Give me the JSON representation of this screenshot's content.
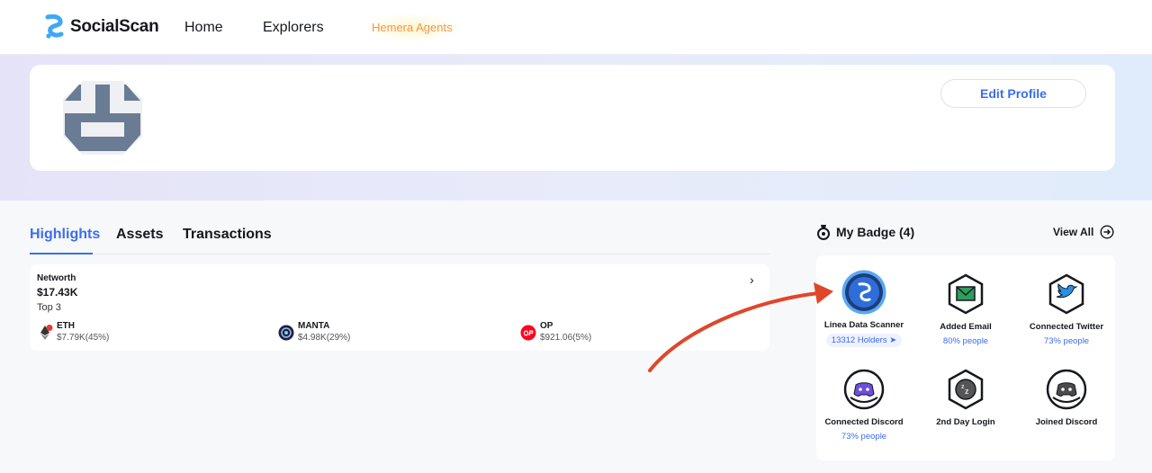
{
  "nav": {
    "brand": "SocialScan",
    "links": [
      "Home",
      "Explorers"
    ],
    "agents_label": "Hemera Agents"
  },
  "profile": {
    "edit_label": "Edit Profile"
  },
  "tabs": [
    "Highlights",
    "Assets",
    "Transactions"
  ],
  "networth": {
    "label": "Networth",
    "value": "$17.43K",
    "top_label": "Top 3",
    "assets": [
      {
        "name": "ETH",
        "value": "$7.79K(45%)"
      },
      {
        "name": "MANTA",
        "value": "$4.98K(29%)"
      },
      {
        "name": "OP",
        "value": "$921.06(5%)"
      }
    ]
  },
  "badges": {
    "title": "My Badge (4)",
    "view_all": "View All",
    "items": [
      {
        "name": "Linea Data Scanner",
        "sub": "13312 Holders",
        "icon": "linea-data-scanner-badge"
      },
      {
        "name": "Added Email",
        "sub": "80% people",
        "icon": "email-badge"
      },
      {
        "name": "Connected Twitter",
        "sub": "73% people",
        "icon": "twitter-badge"
      },
      {
        "name": "Connected Discord",
        "sub": "73% people",
        "icon": "discord-badge"
      },
      {
        "name": "2nd Day Login",
        "sub": "",
        "icon": "sleep-badge"
      },
      {
        "name": "Joined Discord",
        "sub": "",
        "icon": "discord-gray-badge"
      }
    ]
  },
  "colors": {
    "accent": "#3b6df0",
    "agents": "#f2994a",
    "arrow": "#e0462a"
  }
}
